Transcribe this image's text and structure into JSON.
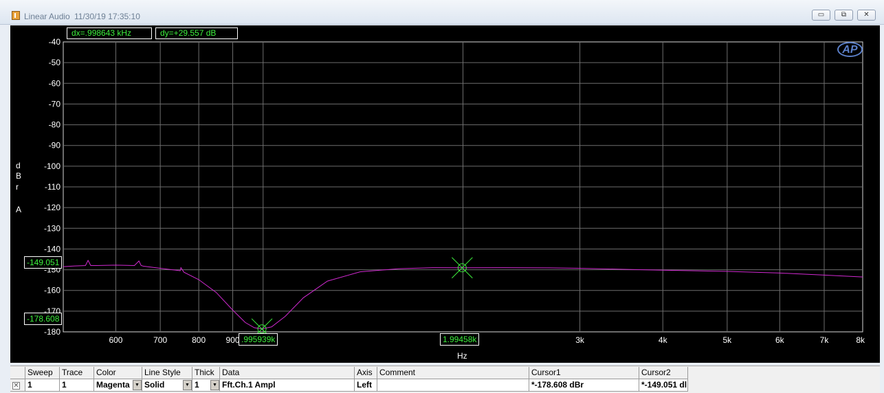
{
  "window": {
    "title": "Linear Audio",
    "timestamp": "11/30/19 17:35:10",
    "buttons": {
      "minimize": "▭",
      "restore": "⧉",
      "close": "✕"
    }
  },
  "readouts": {
    "dx": "dx=.998643 kHz",
    "dy": "dy=+29.557  dB"
  },
  "logo": "AP",
  "y_axis": {
    "unit_letters": [
      "d",
      "B",
      "r",
      "A"
    ]
  },
  "x_axis": {
    "unit": "Hz"
  },
  "cursors": {
    "cursor1": {
      "x_label": ".995939k",
      "y_label": "-178.608"
    },
    "cursor2": {
      "x_label": "1.99458k",
      "y_label": "-149.051"
    }
  },
  "chart_data": {
    "type": "line",
    "x_scale": "log",
    "xlim": [
      500,
      8000
    ],
    "ylim": [
      -180,
      -40
    ],
    "grid": true,
    "x_ticks": [
      {
        "v": 600,
        "label": "600"
      },
      {
        "v": 700,
        "label": "700"
      },
      {
        "v": 800,
        "label": "800"
      },
      {
        "v": 900,
        "label": "900"
      },
      {
        "v": 1000,
        "label": ""
      },
      {
        "v": 2000,
        "label": ""
      },
      {
        "v": 3000,
        "label": "3k"
      },
      {
        "v": 4000,
        "label": "4k"
      },
      {
        "v": 5000,
        "label": "5k"
      },
      {
        "v": 6000,
        "label": "6k"
      },
      {
        "v": 7000,
        "label": "7k"
      },
      {
        "v": 8000,
        "label": "8k"
      }
    ],
    "y_ticks": [
      {
        "v": -40,
        "label": "-40"
      },
      {
        "v": -50,
        "label": "-50"
      },
      {
        "v": -60,
        "label": "-60"
      },
      {
        "v": -70,
        "label": "-70"
      },
      {
        "v": -80,
        "label": "-80"
      },
      {
        "v": -90,
        "label": "-90"
      },
      {
        "v": -100,
        "label": "-100"
      },
      {
        "v": -110,
        "label": "-110"
      },
      {
        "v": -120,
        "label": "-120"
      },
      {
        "v": -130,
        "label": "-130"
      },
      {
        "v": -140,
        "label": "-140"
      },
      {
        "v": -150,
        "label": "-150"
      },
      {
        "v": -160,
        "label": "-160"
      },
      {
        "v": -170,
        "label": "-170"
      },
      {
        "v": -180,
        "label": "-180"
      }
    ],
    "series": [
      {
        "color": "#d22ad2",
        "x": [
          500,
          520,
          540,
          545,
          550,
          560,
          600,
          640,
          650,
          655,
          660,
          700,
          730,
          750,
          752,
          760,
          800,
          850,
          900,
          940,
          970,
          996,
          1030,
          1080,
          1150,
          1250,
          1400,
          1600,
          1800,
          1995,
          2300,
          2700,
          3000,
          3500,
          4000,
          5000,
          6000,
          7000,
          8000
        ],
        "y": [
          -148.5,
          -148.2,
          -148.0,
          -145.5,
          -148.0,
          -148.0,
          -147.8,
          -148.0,
          -145.8,
          -148.0,
          -148.3,
          -149.3,
          -150.0,
          -150.5,
          -149.0,
          -151.2,
          -154.8,
          -161.0,
          -169.5,
          -175.5,
          -178.0,
          -178.6,
          -177.6,
          -172.5,
          -163.5,
          -155.5,
          -151.0,
          -149.5,
          -149.0,
          -149.05,
          -149.0,
          -149.1,
          -149.3,
          -149.8,
          -150.2,
          -150.8,
          -151.6,
          -152.6,
          -153.5
        ]
      }
    ],
    "markers": [
      {
        "x": 996,
        "y": -178.608
      },
      {
        "x": 1994.58,
        "y": -149.051
      }
    ]
  },
  "table": {
    "headers": [
      "Sweep",
      "Trace",
      "Color",
      "Line Style",
      "Thick",
      "Data",
      "Axis",
      "Comment",
      "Cursor1",
      "Cursor2"
    ],
    "row": {
      "checkbox": "✕",
      "sweep": "1",
      "trace": "1",
      "color": "Magenta",
      "line_style": "Solid",
      "thick": "1",
      "data": "Fft.Ch.1 Ampl",
      "axis": "Left",
      "comment": "",
      "cursor1": "*-178.608 dBr",
      "cursor2": "*-149.051 dl"
    },
    "dropdown_glyph": "▼"
  },
  "colors": {
    "trace": "#d22ad2",
    "readout_text": "#3ef03e",
    "marker": "#3ef03e",
    "grid": "#6e6e6e"
  }
}
